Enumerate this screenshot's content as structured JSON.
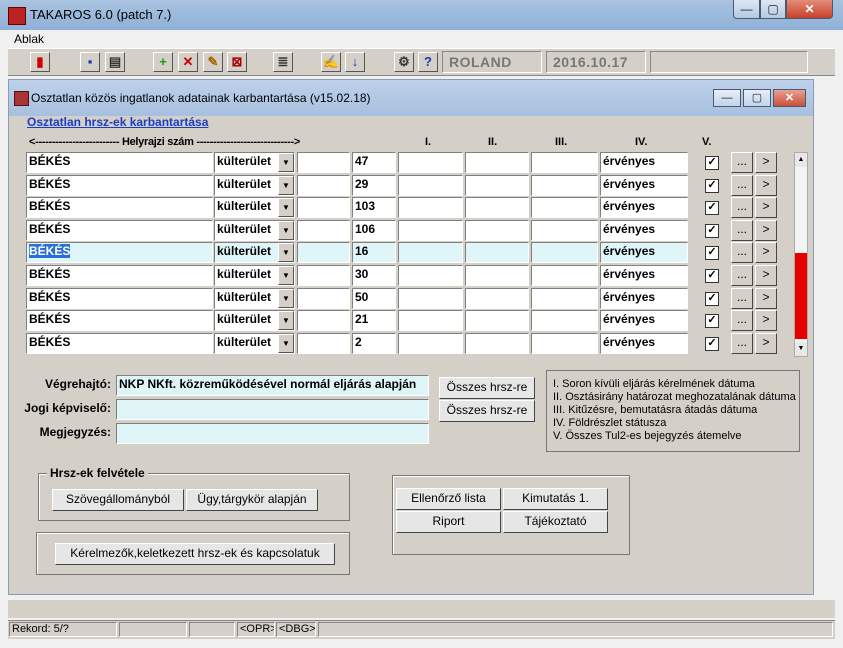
{
  "window": {
    "title": "TAKAROS 6.0 (patch 7.)",
    "min": "—",
    "max": "▢",
    "close": "✕"
  },
  "menu": {
    "ablak": "Ablak"
  },
  "toolbar": {
    "user": "ROLAND",
    "date": "2016.10.17"
  },
  "child": {
    "title": "Osztatlan közös ingatlanok adatainak karbantartása (v15.02.18)",
    "subtitle": "Osztatlan hrsz-ek karbantartása",
    "min": "—",
    "max": "▢",
    "close": "✕"
  },
  "headers": {
    "helyrajzi": "<------------------------- Helyrajzi szám ----------------------------->",
    "c1": "I.",
    "c2": "II.",
    "c3": "III.",
    "c4": "IV.",
    "c5": "V."
  },
  "rows": [
    {
      "city": "BÉKÉS",
      "type": "külterület",
      "num": "47",
      "status": "érvényes",
      "v": "✓"
    },
    {
      "city": "BÉKÉS",
      "type": "külterület",
      "num": "29",
      "status": "érvényes",
      "v": "✓"
    },
    {
      "city": "BÉKÉS",
      "type": "külterület",
      "num": "103",
      "status": "érvényes",
      "v": "✓"
    },
    {
      "city": "BÉKÉS",
      "type": "külterület",
      "num": "106",
      "status": "érvényes",
      "v": "✓"
    },
    {
      "city": "BÉKÉS",
      "type": "külterület",
      "num": "16",
      "status": "érvényes",
      "v": "✓"
    },
    {
      "city": "BÉKÉS",
      "type": "külterület",
      "num": "30",
      "status": "érvényes",
      "v": "✓"
    },
    {
      "city": "BÉKÉS",
      "type": "külterület",
      "num": "50",
      "status": "érvényes",
      "v": "✓"
    },
    {
      "city": "BÉKÉS",
      "type": "külterület",
      "num": "21",
      "status": "érvényes",
      "v": "✓"
    },
    {
      "city": "BÉKÉS",
      "type": "külterület",
      "num": "2",
      "status": "érvényes",
      "v": "✓"
    }
  ],
  "row_buttons": {
    "dots": "...",
    "next": ">"
  },
  "form": {
    "vegrehajto_label": "Végrehajtó:",
    "vegrehajto_value": "NKP NKft. közreműködésével normál eljárás alapján",
    "jogi_label": "Jogi képviselő:",
    "jogi_value": "",
    "megj_label": "Megjegyzés:",
    "megj_value": "",
    "osszes1": "Összes hrsz-re",
    "osszes2": "Összes hrsz-re"
  },
  "legend": [
    "I.   Soron kívüli eljárás kérelmének dátuma",
    "II.  Osztásirány határozat meghozatalának dátuma",
    "III. Kitűzésre, bemutatásra átadás dátuma",
    "IV.  Földrészlet státusza",
    "V.   Összes Tul2-es bejegyzés átemelve"
  ],
  "hrsz_group": {
    "label": "Hrsz-ek felvétele",
    "btn1": "Szövegállományból",
    "btn2": "Ügy,tárgykör alapján"
  },
  "kerelmezok_btn": "Kérelmezők,keletkezett hrsz-ek és kapcsolatuk",
  "actions": {
    "ellenorzo": "Ellenőrző lista",
    "kimutatas": "Kimutatás 1.",
    "riport": "Riport",
    "tajekoztato": "Tájékoztató"
  },
  "status": {
    "rekord": "Rekord: 5/?",
    "opr": "<OPR>",
    "dbg": "<DBG>"
  }
}
